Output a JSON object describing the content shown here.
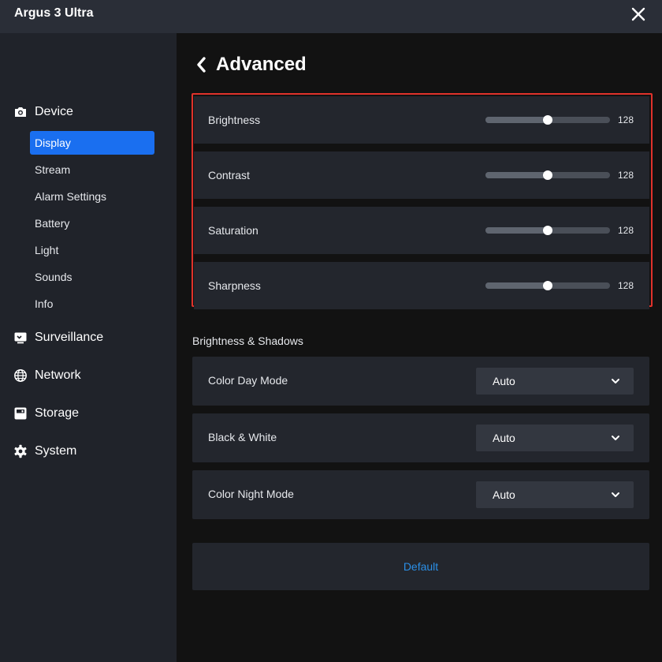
{
  "app": {
    "title": "Argus 3 Ultra"
  },
  "titlebar": {
    "close_icon": "close-icon"
  },
  "sidebar": {
    "categories": [
      {
        "key": "device",
        "label": "Device",
        "icon": "camera-icon"
      },
      {
        "key": "surveillance",
        "label": "Surveillance",
        "icon": "monitor-icon"
      },
      {
        "key": "network",
        "label": "Network",
        "icon": "globe-icon"
      },
      {
        "key": "storage",
        "label": "Storage",
        "icon": "storage-icon"
      },
      {
        "key": "system",
        "label": "System",
        "icon": "gear-icon"
      }
    ],
    "device_items": [
      {
        "label": "Display",
        "active": true
      },
      {
        "label": "Stream",
        "active": false
      },
      {
        "label": "Alarm Settings",
        "active": false
      },
      {
        "label": "Battery",
        "active": false
      },
      {
        "label": "Light",
        "active": false
      },
      {
        "label": "Sounds",
        "active": false
      },
      {
        "label": "Info",
        "active": false
      }
    ]
  },
  "page": {
    "title": "Advanced",
    "back_icon": "chevron-left-icon"
  },
  "sliders": [
    {
      "label": "Brightness",
      "value": "128",
      "fraction": 0.5
    },
    {
      "label": "Contrast",
      "value": "128",
      "fraction": 0.5
    },
    {
      "label": "Saturation",
      "value": "128",
      "fraction": 0.5
    },
    {
      "label": "Sharpness",
      "value": "128",
      "fraction": 0.5
    }
  ],
  "brightness_shadows": {
    "title": "Brightness & Shadows",
    "modes": [
      {
        "label": "Color Day Mode",
        "value": "Auto"
      },
      {
        "label": "Black & White",
        "value": "Auto"
      },
      {
        "label": "Color Night Mode",
        "value": "Auto"
      }
    ]
  },
  "default_button": {
    "label": "Default"
  },
  "colors": {
    "accent": "#1a6ff0",
    "highlight_border": "#e0322b",
    "link": "#2b8fe6",
    "sidebar_bg": "#20232a",
    "panel_bg": "#23262d"
  }
}
